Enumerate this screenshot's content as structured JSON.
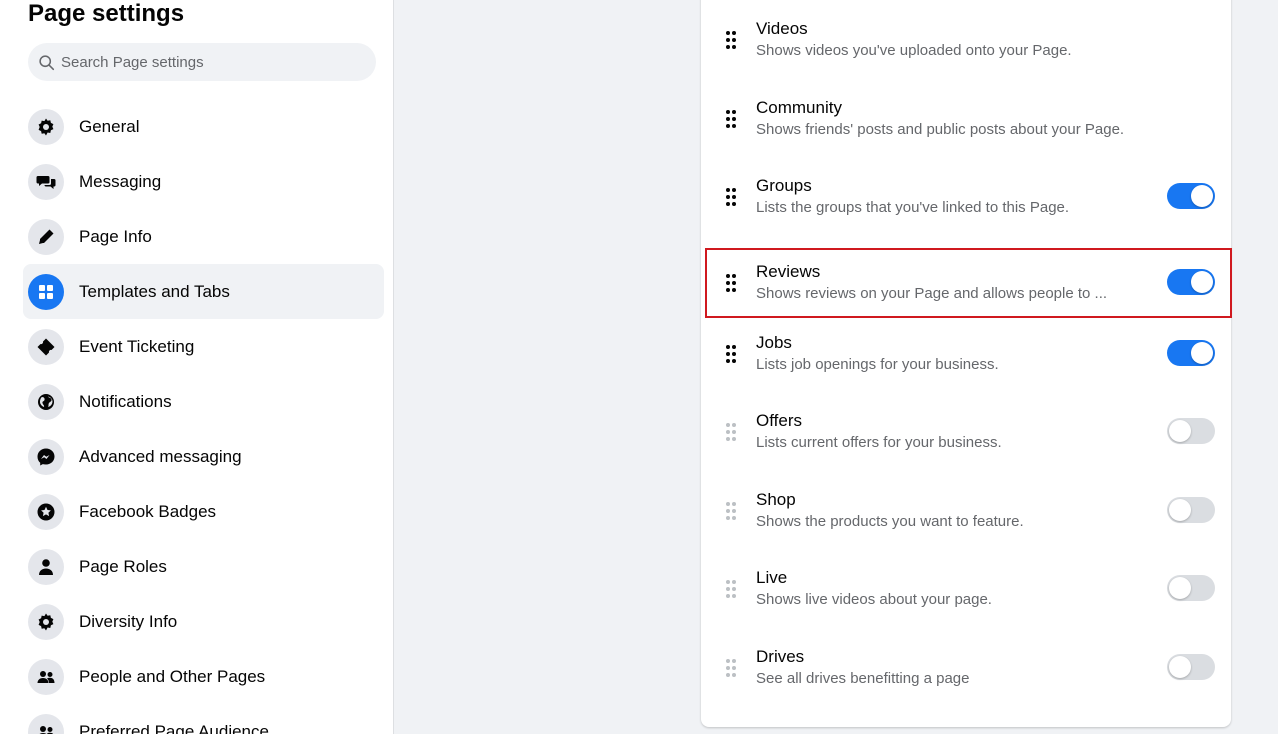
{
  "sidebar": {
    "title": "Page settings",
    "search_placeholder": "Search Page settings",
    "items": [
      {
        "label": "General",
        "icon": "gear-icon"
      },
      {
        "label": "Messaging",
        "icon": "chat-bubbles-icon"
      },
      {
        "label": "Page Info",
        "icon": "pencil-icon"
      },
      {
        "label": "Templates and Tabs",
        "icon": "grid-icon",
        "active": true
      },
      {
        "label": "Event Ticketing",
        "icon": "ticket-icon"
      },
      {
        "label": "Notifications",
        "icon": "globe-icon"
      },
      {
        "label": "Advanced messaging",
        "icon": "messenger-icon"
      },
      {
        "label": "Facebook Badges",
        "icon": "badge-star-icon"
      },
      {
        "label": "Page Roles",
        "icon": "person-icon"
      },
      {
        "label": "Diversity Info",
        "icon": "gear-icon"
      },
      {
        "label": "People and Other Pages",
        "icon": "people-icon"
      },
      {
        "label": "Preferred Page Audience",
        "icon": "people-icon"
      }
    ]
  },
  "tabs": [
    {
      "title": "Videos",
      "description": "Shows videos you've uploaded onto your Page.",
      "toggle": null,
      "draggable": true
    },
    {
      "title": "Community",
      "description": "Shows friends' posts and public posts about your Page.",
      "toggle": null,
      "draggable": true
    },
    {
      "title": "Groups",
      "description": "Lists the groups that you've linked to this Page.",
      "toggle": "on",
      "draggable": true
    },
    {
      "title": "Reviews",
      "description": "Shows reviews on your Page and allows people to ...",
      "toggle": "on",
      "draggable": true,
      "highlighted": true
    },
    {
      "title": "Jobs",
      "description": "Lists job openings for your business.",
      "toggle": "on",
      "draggable": true
    },
    {
      "title": "Offers",
      "description": "Lists current offers for your business.",
      "toggle": "off",
      "draggable": false
    },
    {
      "title": "Shop",
      "description": "Shows the products you want to feature.",
      "toggle": "off",
      "draggable": false
    },
    {
      "title": "Live",
      "description": "Shows live videos about your page.",
      "toggle": "off",
      "draggable": false
    },
    {
      "title": "Drives",
      "description": "See all drives benefitting a page",
      "toggle": "off",
      "draggable": false
    }
  ],
  "colors": {
    "accent": "#1877f2",
    "highlight_border": "#d0191f",
    "background": "#f0f2f5"
  }
}
